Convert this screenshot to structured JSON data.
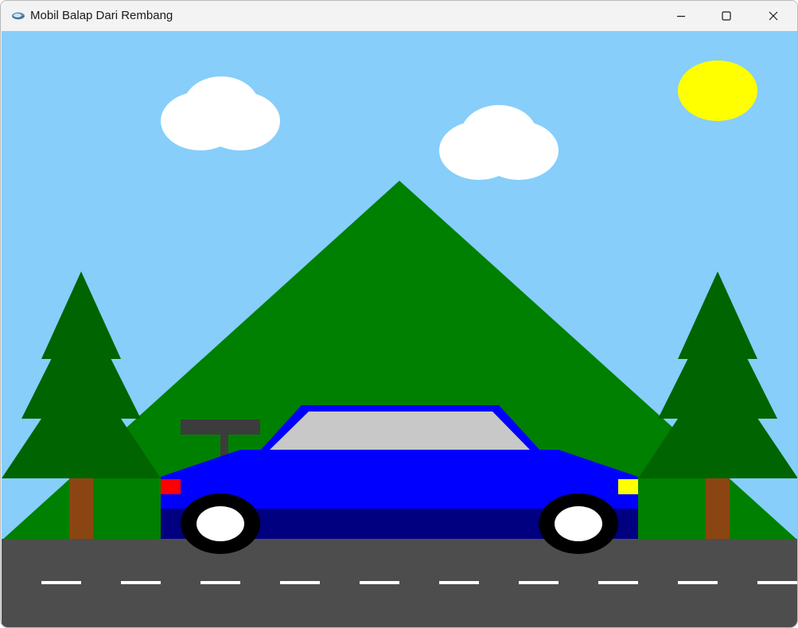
{
  "window": {
    "title": "Mobil Balap Dari Rembang",
    "controls": [
      "minimize-icon",
      "maximize-icon",
      "close-icon"
    ]
  },
  "scene": {
    "icons": [
      "app-icon",
      "sun",
      "cloud",
      "mountain",
      "pine-tree",
      "race-car",
      "road"
    ],
    "colors": {
      "sky": "#87CEFA",
      "sun": "#FFFF00",
      "cloud": "#FFFFFF",
      "mountain": "#008000",
      "tree_foliage": "#006400",
      "tree_trunk": "#8B4513",
      "road": "#4D4D4D",
      "lane_marking": "#FFFFFF",
      "car_body": "#0000FF",
      "car_lower": "#000080",
      "car_window": "#C8C8C8",
      "spoiler": "#3C3C3C",
      "tail_light": "#FF0000",
      "head_light": "#FFFF00",
      "tire": "#000000",
      "hubcap": "#FFFFFF"
    }
  }
}
